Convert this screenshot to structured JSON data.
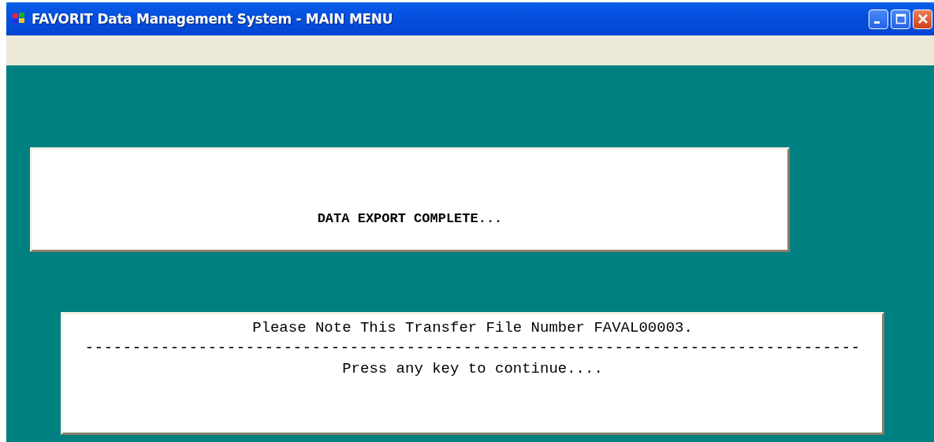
{
  "window": {
    "title": "FAVORIT Data Management System - MAIN MENU"
  },
  "status_box": {
    "message": "DATA EXPORT COMPLETE..."
  },
  "note_box": {
    "lines": [
      {
        "kind": "text",
        "text": "Please Note This Transfer File Number FAVAL00003."
      },
      {
        "kind": "separator",
        "text": "----------------------------------------------------------------------------------"
      },
      {
        "kind": "text",
        "text": "Press any key to continue...."
      }
    ]
  }
}
